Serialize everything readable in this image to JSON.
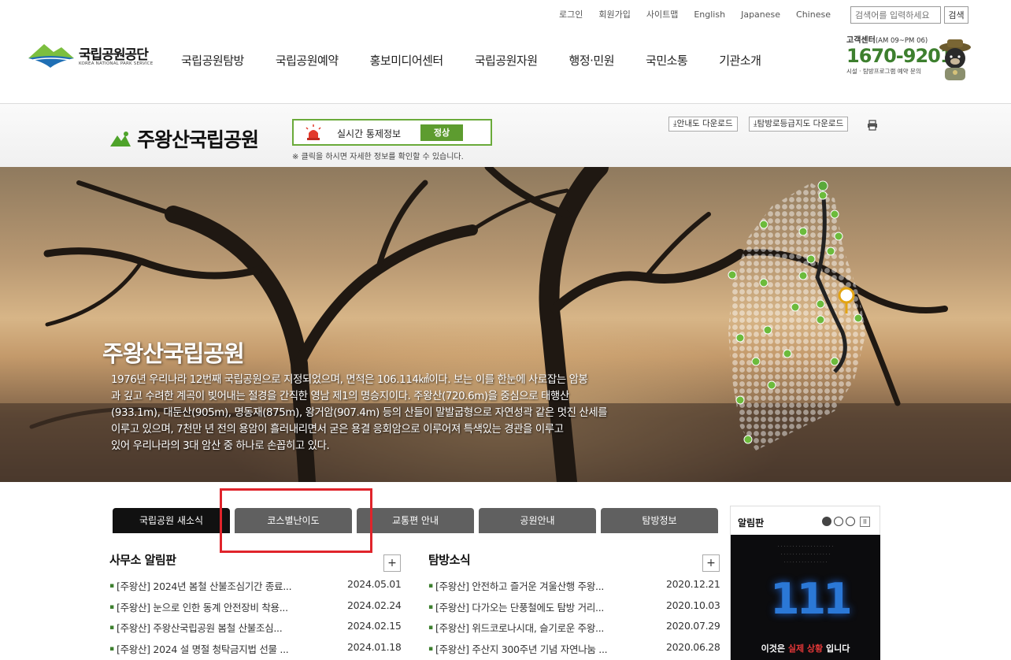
{
  "header": {
    "util_links": [
      "로그인",
      "회원가입",
      "사이트맵",
      "English",
      "Japanese",
      "Chinese"
    ],
    "search_placeholder": "검색어를 입력하세요",
    "search_button": "검색",
    "logo_kr": "국립공원공단",
    "logo_en": "KOREA NATIONAL PARK SERVICE",
    "gnb": [
      "국립공원탐방",
      "국립공원예약",
      "홍보미디어센터",
      "국립공원자원",
      "행정·민원",
      "국민소통",
      "기관소개"
    ],
    "cs_title": "고객센터",
    "cs_hours": "(AM 09~PM 06)",
    "cs_phone": "1670-9201",
    "cs_desc": "시설 · 탐방프로그램 예약 문의"
  },
  "park": {
    "title": "주왕산국립공원",
    "status_label": "실시간 통제정보",
    "status_value": "정상",
    "status_note": "※ 클릭을 하시면 자세한 정보를 확인할 수 있습니다.",
    "download_map": "안내도 다운로드",
    "download_trail": "탐방로등급지도 다운로드"
  },
  "hero": {
    "title": "주왕산국립공원",
    "lines": [
      "1976년 우리나라 12번째 국립공원으로 지정되었으며, 면적은 106.114㎢이다. 보는 이를 한눈에 사로잡는 암봉",
      "과 깊고 수려한 계곡이 빚어내는 절경을 간직한 영남 제1의 명승지이다. 주왕산(720.6m)을 중심으로 태행산",
      "(933.1m), 대둔산(905m), 명동재(875m), 왕거암(907.4m) 등의 산들이 말발굽형으로 자연성곽 같은 멋진 산세를",
      "이루고 있으며, 7천만 년 전의 용암이 흘러내리면서 굳은 용결 응회암으로 이루어져 특색있는 경관을 이루고",
      "있어 우리나라의 3대 암산 중 하나로 손꼽히고 있다."
    ]
  },
  "tabs": [
    "국립공원 새소식",
    "코스별난이도",
    "교통편 안내",
    "공원안내",
    "탐방정보"
  ],
  "boards": {
    "office": {
      "title": "사무소 알림판",
      "more": "+",
      "items": [
        {
          "text": "[주왕산] 2024년 봄철 산불조심기간 종료...",
          "date": "2024.05.01"
        },
        {
          "text": "[주왕산] 눈으로 인한 동계 안전장비 착용...",
          "date": "2024.02.24"
        },
        {
          "text": "[주왕산] 주왕산국립공원 봄철 산불조심...",
          "date": "2024.02.15"
        },
        {
          "text": "[주왕산] 2024 설 명절 청탁금지법 선물 ...",
          "date": "2024.01.18"
        }
      ]
    },
    "visit": {
      "title": "탐방소식",
      "more": "+",
      "items": [
        {
          "text": "[주왕산] 안전하고 즐거운 겨울산행 주왕...",
          "date": "2020.12.21"
        },
        {
          "text": "[주왕산] 다가오는 단풍철에도 탐방 거리...",
          "date": "2020.10.03"
        },
        {
          "text": "[주왕산] 위드코로나시대, 슬기로운 주왕...",
          "date": "2020.07.29"
        },
        {
          "text": "[주왕산] 주산지 300주년 기념 자연나눔 ...",
          "date": "2020.06.28"
        }
      ]
    }
  },
  "notice": {
    "title": "알림판",
    "pause": "II",
    "poster_number": "111",
    "poster_main_prefix": "이것은 ",
    "poster_main_highlight": "실제 상황",
    "poster_main_suffix": " 입니다"
  },
  "colors": {
    "brand_green": "#3d7f2e",
    "status_green": "#5d9c2f",
    "tab_active": "#111111",
    "tab_inactive": "#606060",
    "highlight_red": "#e0242b"
  }
}
